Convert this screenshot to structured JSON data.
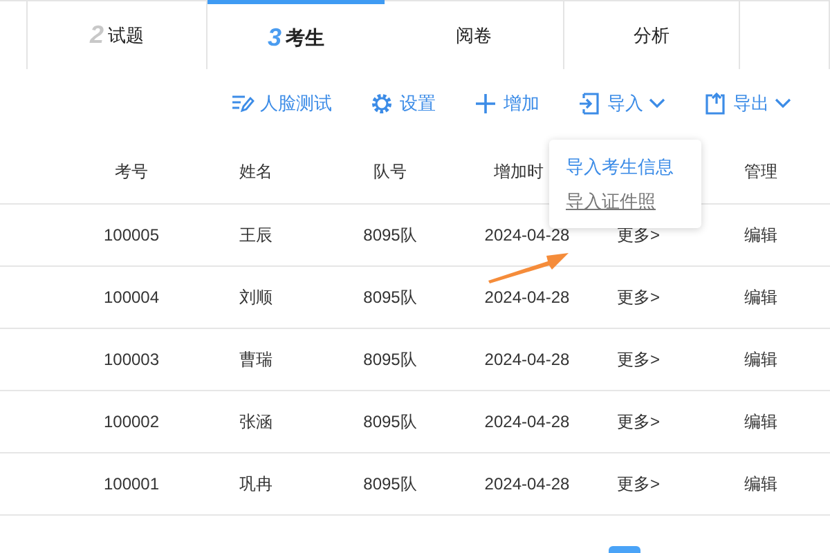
{
  "tabs": [
    {
      "selected": false
    },
    {
      "number": "2",
      "label": "试题",
      "selected": false
    },
    {
      "number": "3",
      "label": "考生",
      "selected": true
    },
    {
      "label": "阅卷",
      "selected": false
    },
    {
      "label": "分析",
      "selected": false
    },
    {
      "selected": false
    }
  ],
  "toolbar": [
    {
      "kind": "face",
      "label": "人脸测试",
      "dropdown": false
    },
    {
      "kind": "gear",
      "label": "设置",
      "dropdown": false
    },
    {
      "kind": "plus",
      "label": "增加",
      "dropdown": false
    },
    {
      "kind": "import",
      "label": "导入",
      "dropdown": true
    },
    {
      "kind": "export",
      "label": "导出",
      "dropdown": true
    }
  ],
  "table": {
    "columns": [
      "考号",
      "姓名",
      "队号",
      "增加时",
      "",
      "管理"
    ],
    "rows": [
      [
        "100005",
        "王辰",
        "8095队",
        "2024-04-28",
        "更多>",
        "编辑"
      ],
      [
        "100004",
        "刘顺",
        "8095队",
        "2024-04-28",
        "更多>",
        "编辑"
      ],
      [
        "100003",
        "曹瑞",
        "8095队",
        "2024-04-28",
        "更多>",
        "编辑"
      ],
      [
        "100002",
        "张涵",
        "8095队",
        "2024-04-28",
        "更多>",
        "编辑"
      ],
      [
        "100001",
        "巩冉",
        "8095队",
        "2024-04-28",
        "更多>",
        "编辑"
      ]
    ]
  },
  "import_menu": [
    {
      "label": "导入考生信息",
      "selected": true
    },
    {
      "label": "导入证件照",
      "selected": false
    }
  ]
}
